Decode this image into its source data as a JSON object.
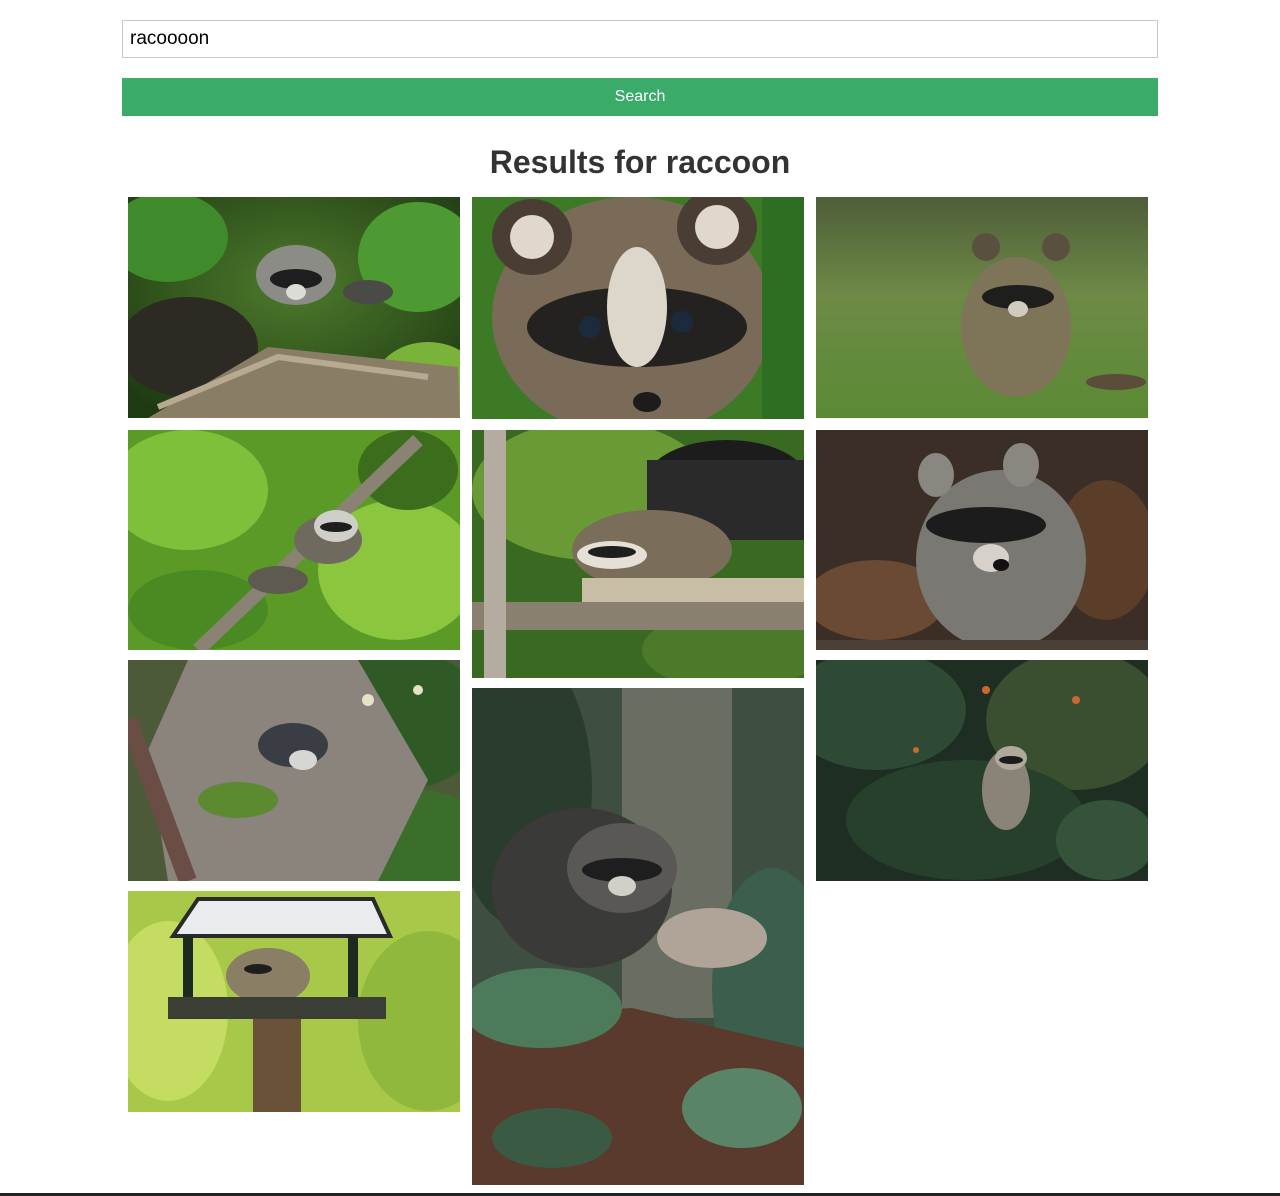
{
  "search": {
    "value": "racoooon",
    "button_label": "Search"
  },
  "results": {
    "heading": "Results for raccoon"
  }
}
